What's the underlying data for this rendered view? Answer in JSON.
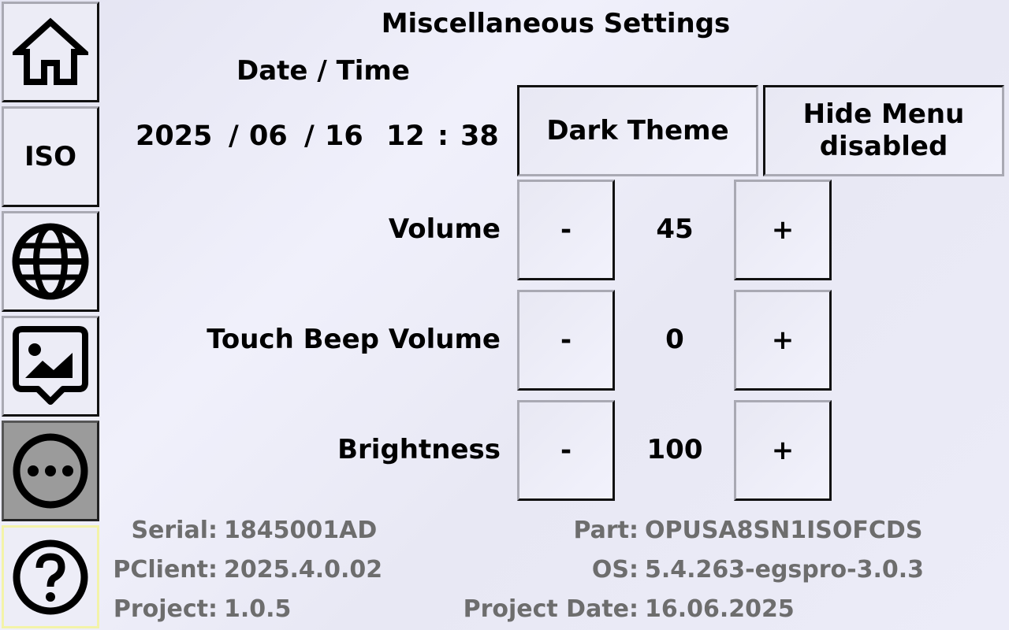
{
  "sidebar": {
    "items": [
      {
        "name": "home",
        "icon": "home-icon"
      },
      {
        "name": "iso",
        "label": "ISO"
      },
      {
        "name": "language",
        "icon": "globe-icon"
      },
      {
        "name": "image",
        "icon": "image-message-icon"
      },
      {
        "name": "more",
        "icon": "more-icon",
        "active": true
      },
      {
        "name": "help",
        "icon": "help-icon"
      }
    ]
  },
  "page": {
    "title": "Miscellaneous Settings"
  },
  "datetime": {
    "label": "Date / Time",
    "year": "2025",
    "sep1": "/",
    "month": "06",
    "sep2": "/",
    "day": "16",
    "hour": "12",
    "colon": ":",
    "minute": "38"
  },
  "buttons": {
    "dark_theme": "Dark Theme",
    "hide_menu_line1": "Hide Menu",
    "hide_menu_line2": "disabled"
  },
  "controls": {
    "minus": "-",
    "plus": "+",
    "volume": {
      "label": "Volume",
      "value": "45"
    },
    "touch_beep": {
      "label": "Touch Beep Volume",
      "value": "0"
    },
    "brightness": {
      "label": "Brightness",
      "value": "100"
    }
  },
  "info": {
    "serial_label": "Serial:",
    "serial_value": "1845001AD",
    "pclient_label": "PClient:",
    "pclient_value": "2025.4.0.02",
    "project_label": "Project:",
    "project_value": "1.0.5",
    "part_label": "Part:",
    "part_value": "OPUSA8SN1ISOFCDS",
    "os_label": "OS:",
    "os_value": "5.4.263-egspro-3.0.3",
    "project_date_label": "Project Date:",
    "project_date_value": "16.06.2025"
  },
  "colors": {
    "active_sidebar": "#9b9b9b",
    "info_text": "#6d6d6d",
    "help_border": "#f3f3a8"
  }
}
